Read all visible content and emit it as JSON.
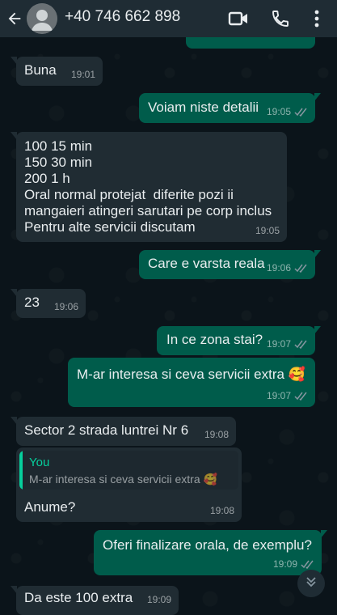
{
  "header": {
    "contact": "+40 746 662 898"
  },
  "messages": [
    {
      "text": "Buna",
      "time": "19:01"
    },
    {
      "text": "Voiam niste detalii",
      "time": "19:05"
    },
    {
      "text": "100 15 min\n150 30 min\n200 1 h\nOral normal protejat  diferite pozi ii\nmangaieri atingeri sarutari pe corp inclus\nPentru alte servicii discutam",
      "time": "19:05"
    },
    {
      "text": "Care e varsta reala",
      "time": "19:06"
    },
    {
      "text": "23",
      "time": "19:06"
    },
    {
      "text": "In ce zona stai?",
      "time": "19:07"
    },
    {
      "text": "M-ar interesa si ceva servicii extra 🥰",
      "time": "19:07"
    },
    {
      "text": "Sector 2 strada luntrei Nr 6",
      "time": "19:08"
    },
    {
      "quote_name": "You",
      "quote_text": "M-ar interesa si ceva servicii extra 🥰",
      "text": "Anume?",
      "time": "19:08"
    },
    {
      "text": "Oferi finalizare orala, de exemplu?",
      "time": "19:09"
    },
    {
      "text": "Da este 100 extra",
      "time": "19:09"
    }
  ],
  "colors": {
    "background": "#0b141a",
    "header": "#1f2c34",
    "incoming_bubble": "#202c33",
    "outgoing_bubble": "#005c4b",
    "read_ticks": "#8696a0",
    "quote_accent": "#06cf9c"
  },
  "icons": [
    "back-arrow-icon",
    "avatar-placeholder-icon",
    "video-call-icon",
    "phone-icon",
    "more-vertical-icon",
    "double-check-icon",
    "chevron-double-down-icon"
  ]
}
